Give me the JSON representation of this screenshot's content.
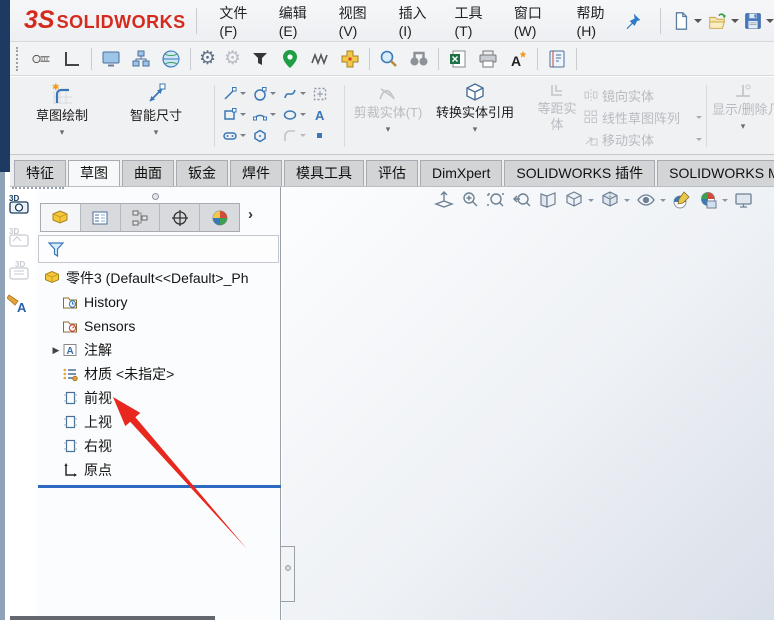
{
  "brand": {
    "mark": "3S",
    "name": "SOLIDWORKS"
  },
  "menubar": {
    "items": [
      "文件(F)",
      "编辑(E)",
      "视图(V)",
      "插入(I)",
      "工具(T)",
      "窗口(W)",
      "帮助(H)"
    ]
  },
  "quick_access": {
    "icons": [
      "pin",
      "new-document",
      "open-document",
      "save"
    ]
  },
  "toolbar_icons": [
    "screw",
    "angle",
    "monitor",
    "network",
    "globe",
    "gear",
    "gear-secondary",
    "funnel",
    "pin-marker",
    "spring",
    "pipe-fitting",
    "magnifier",
    "binoculars",
    "excel-export",
    "print",
    "new-note",
    "help-book"
  ],
  "ribbon": {
    "sketch_label": "草图绘制",
    "smart_dimension_label": "智能尺寸",
    "trim_label": "剪裁实体(T)",
    "convert_label": "转换实体引用",
    "offset_line1": "等距实",
    "offset_line2": "体",
    "mirror_label": "镜向实体",
    "linear_pattern_label": "线性草图阵列",
    "move_label": "移动实体",
    "display_delete_label": "显示/删除几何关"
  },
  "tabs": {
    "items": [
      "特征",
      "草图",
      "曲面",
      "钣金",
      "焊件",
      "模具工具",
      "评估",
      "DimXpert",
      "SOLIDWORKS 插件",
      "SOLIDWORKS MBD"
    ],
    "active_index": 1
  },
  "feature_tree": {
    "root_label": "零件3 (Default<<Default>_Ph",
    "items": [
      {
        "label": "History",
        "icon": "history-folder"
      },
      {
        "label": "Sensors",
        "icon": "sensors-folder"
      },
      {
        "label": "注解",
        "icon": "annotations-folder",
        "expandable": true
      },
      {
        "label": "材质 <未指定>",
        "icon": "material"
      },
      {
        "label": "前视",
        "icon": "plane"
      },
      {
        "label": "上视",
        "icon": "plane"
      },
      {
        "label": "右视",
        "icon": "plane"
      },
      {
        "label": "原点",
        "icon": "origin"
      }
    ]
  },
  "headsup_icons": [
    "zoom-to-fit",
    "zoom-in-out",
    "zoom-to-area",
    "previous-view",
    "section-view",
    "view-orientation",
    "display-style",
    "hide-show-items",
    "edit-appearance",
    "apply-scene",
    "view-settings"
  ],
  "side_toolbar_icons": [
    "3d-views",
    "3d-tool-disabled-1",
    "3d-tool-disabled-2",
    "annotation-paint"
  ],
  "panel_tab_icons": [
    "featuremanager-part",
    "propertymanager",
    "configurationmanager",
    "dimxpertmanager",
    "displaymanager"
  ],
  "colors": {
    "rollback_blue": "#2e6ac1",
    "arrow_red": "#e8281e",
    "logo_red": "#d52b1e",
    "titlebar_navy": "#1d3a63"
  }
}
